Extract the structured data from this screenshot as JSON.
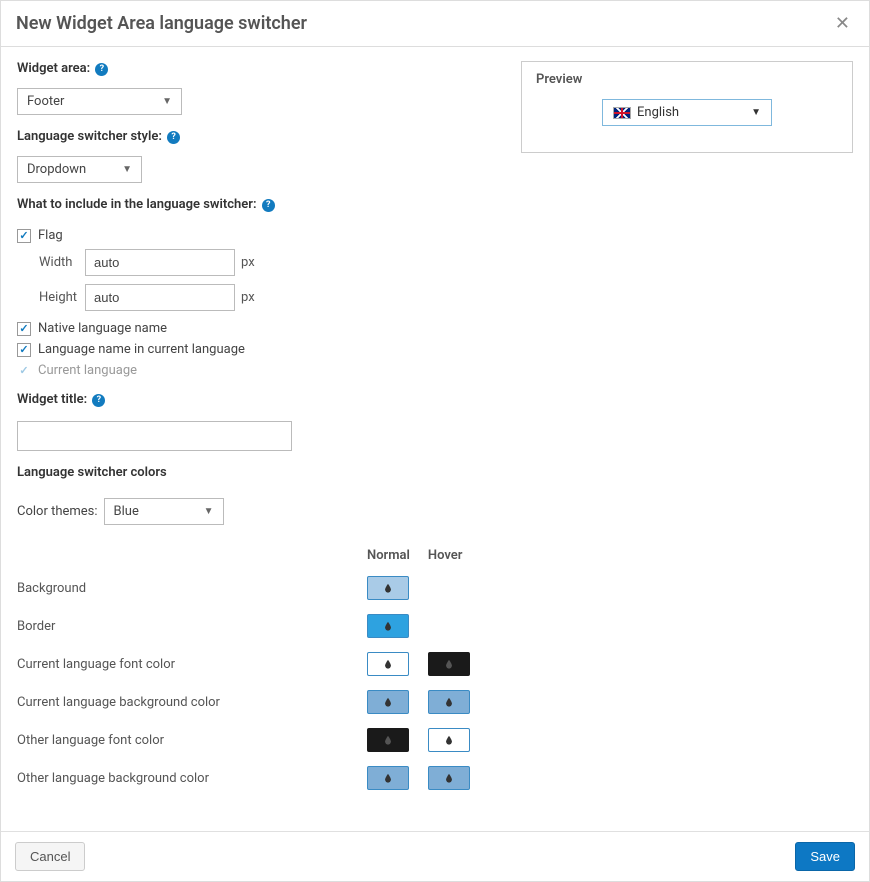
{
  "header": {
    "title": "New Widget Area language switcher"
  },
  "labels": {
    "widget_area": "Widget area:",
    "style": "Language switcher style:",
    "include": "What to include in the language switcher:",
    "widget_title": "Widget title:",
    "colors": "Language switcher colors",
    "color_themes": "Color themes:",
    "preview": "Preview",
    "normal": "Normal",
    "hover": "Hover",
    "width": "Width",
    "height": "Height",
    "px": "px"
  },
  "widget_area": {
    "value": "Footer"
  },
  "style": {
    "value": "Dropdown"
  },
  "include": {
    "flag": {
      "label": "Flag",
      "checked": true,
      "width": "auto",
      "height": "auto"
    },
    "native": {
      "label": "Native language name",
      "checked": true
    },
    "current_name": {
      "label": "Language name in current language",
      "checked": true
    },
    "current_lang": {
      "label": "Current language",
      "checked": true,
      "disabled": true
    }
  },
  "widget_title": {
    "value": ""
  },
  "color_theme": {
    "value": "Blue"
  },
  "color_rows": [
    {
      "label": "Background",
      "normal": "lightblue",
      "hover": null
    },
    {
      "label": "Border",
      "normal": "medblue",
      "hover": null
    },
    {
      "label": "Current language font color",
      "normal": "white",
      "hover": "black"
    },
    {
      "label": "Current language background color",
      "normal": "dimblue",
      "hover": "dimblue"
    },
    {
      "label": "Other language font color",
      "normal": "black",
      "hover": "white"
    },
    {
      "label": "Other language background color",
      "normal": "dimblue",
      "hover": "dimblue"
    }
  ],
  "preview": {
    "language": "English"
  },
  "footer": {
    "cancel": "Cancel",
    "save": "Save"
  }
}
